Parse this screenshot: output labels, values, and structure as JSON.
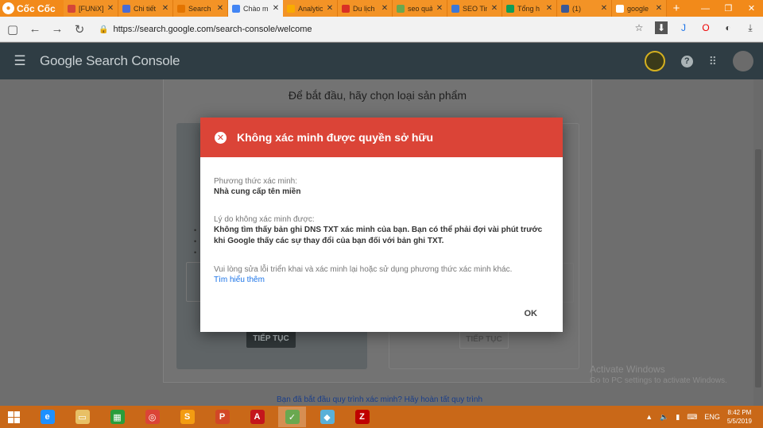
{
  "browser": {
    "brand": "Cốc Cốc",
    "tabs": [
      {
        "title": "[FUNiX]",
        "favicon_color": "#d44638",
        "active": false
      },
      {
        "title": "Chi tiết",
        "favicon_color": "#4a6cd4",
        "active": false
      },
      {
        "title": "Search",
        "favicon_color": "#e37400",
        "active": false
      },
      {
        "title": "Chào m",
        "favicon_color": "#4285f4",
        "active": true
      },
      {
        "title": "Analytic",
        "favicon_color": "#f9ab00",
        "active": false
      },
      {
        "title": "Du lịch",
        "favicon_color": "#d93025",
        "active": false
      },
      {
        "title": "seo quả",
        "favicon_color": "#6aa84f",
        "active": false
      },
      {
        "title": "SEO Tin",
        "favicon_color": "#3c78d8",
        "active": false
      },
      {
        "title": "Tổng h",
        "favicon_color": "#0f9d58",
        "active": false
      },
      {
        "title": "(1)",
        "favicon_color": "#3b5998",
        "active": false
      },
      {
        "title": "google",
        "favicon_color": "#ffffff",
        "active": false
      }
    ],
    "new_tab": "+",
    "window_controls": [
      "—",
      "❐",
      "✕"
    ],
    "url": "https://search.google.com/search-console/welcome"
  },
  "app": {
    "title": "Google Search Console"
  },
  "page": {
    "heading": "Để bắt đầu, hãy chọn loại sản phẩm",
    "button_left": "TIẾP TỤC",
    "button_right": "TIẾP TỤC",
    "footer_link": "Bạn đã bắt đầu quy trình xác minh? Hãy hoàn tất quy trình"
  },
  "dialog": {
    "title": "Không xác minh được quyền sở hữu",
    "method_label": "Phương thức xác minh:",
    "method_value": "Nhà cung cấp tên miền",
    "reason_label": "Lý do không xác minh được:",
    "reason_value": "Không tìm thấy bản ghi DNS TXT xác minh của bạn. Bạn có thể phải đợi vài phút trước khi Google thấy các sự thay đổi của bạn đối với bản ghi TXT.",
    "hint": "Vui lòng sửa lỗi triển khai và xác minh lại hoặc sử dụng phương thức xác minh khác.",
    "learn_more": "Tìm hiểu thêm",
    "ok": "OK",
    "header_color": "#db4437"
  },
  "watermark": {
    "line1": "Activate Windows",
    "line2": "Go to PC settings to activate Windows."
  },
  "taskbar": {
    "apps": [
      {
        "name": "internet-explorer",
        "glyph": "e",
        "color": "#1e90ff"
      },
      {
        "name": "file-explorer",
        "glyph": "▭",
        "color": "#e8c065"
      },
      {
        "name": "store",
        "glyph": "▦",
        "color": "#2a9d3a"
      },
      {
        "name": "chrome",
        "glyph": "◎",
        "color": "#db4437"
      },
      {
        "name": "sublime",
        "glyph": "S",
        "color": "#f39c12"
      },
      {
        "name": "powerpoint",
        "glyph": "P",
        "color": "#d24726"
      },
      {
        "name": "acrobat",
        "glyph": "A",
        "color": "#c4161c"
      },
      {
        "name": "coccoc",
        "glyph": "✓",
        "color": "#6aa84f"
      },
      {
        "name": "app-blue",
        "glyph": "◆",
        "color": "#5ab0d8"
      },
      {
        "name": "filezilla",
        "glyph": "Z",
        "color": "#bf0000"
      }
    ],
    "language": "ENG",
    "time": "8:42 PM",
    "date": "5/5/2019"
  }
}
